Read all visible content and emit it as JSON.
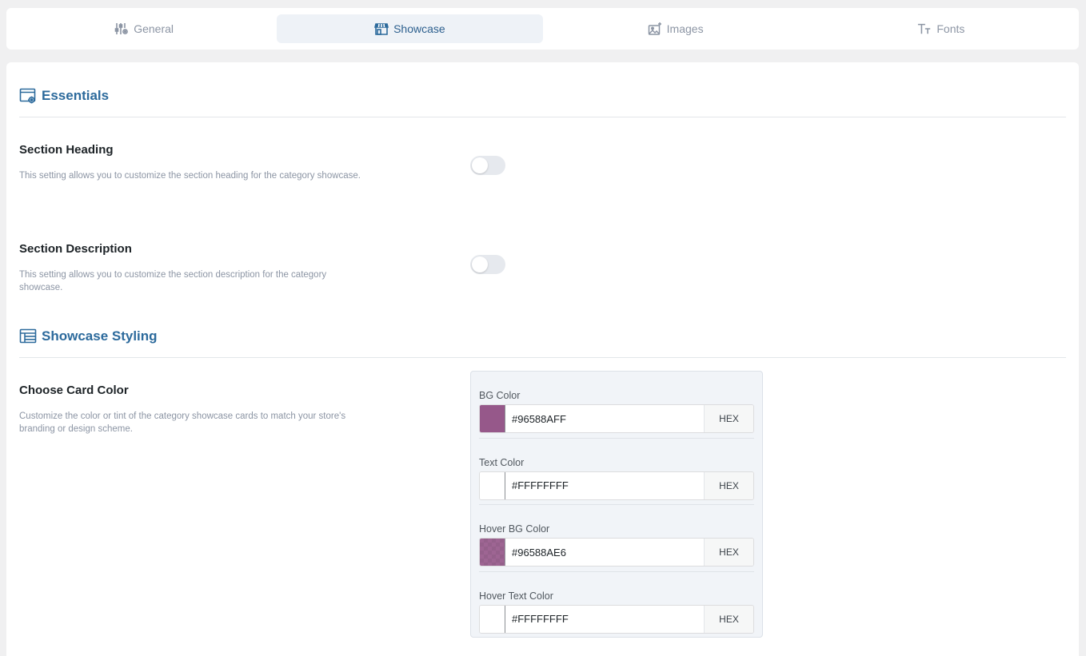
{
  "tabs": [
    {
      "label": "General",
      "icon": "sliders-icon",
      "active": false
    },
    {
      "label": "Showcase",
      "icon": "storefront-icon",
      "active": true
    },
    {
      "label": "Images",
      "icon": "image-sparkle-icon",
      "active": false
    },
    {
      "label": "Fonts",
      "icon": "text-size-icon",
      "active": false
    }
  ],
  "sections": {
    "essentials": {
      "title": "Essentials",
      "icon": "window-gear-icon"
    },
    "styling": {
      "title": "Showcase Styling",
      "icon": "layout-table-icon"
    }
  },
  "settings": {
    "section_heading": {
      "title": "Section Heading",
      "description": "This setting allows you to customize the section heading for the category showcase.",
      "enabled": false
    },
    "section_description": {
      "title": "Section Description",
      "description": "This setting allows you to customize the section description for the category showcase.",
      "enabled": false
    },
    "card_color": {
      "title": "Choose Card Color",
      "description": "Customize the color or tint of the category showcase cards to match your store's branding or design scheme."
    }
  },
  "colors": [
    {
      "label": "BG Color",
      "value": "#96588AFF",
      "mode": "HEX",
      "swatch": "#96588a"
    },
    {
      "label": "Text Color",
      "value": "#FFFFFFFF",
      "mode": "HEX",
      "swatch": "#ffffff"
    },
    {
      "label": "Hover BG Color",
      "value": "#96588AE6",
      "mode": "HEX",
      "swatch": "#96588ae6"
    },
    {
      "label": "Hover Text Color",
      "value": "#FFFFFFFF",
      "mode": "HEX",
      "swatch": "#ffffff"
    }
  ],
  "theme": {
    "accent": "#2c6a9c",
    "active_tab_bg": "#eef2f7",
    "muted_text": "#8c95a4"
  }
}
